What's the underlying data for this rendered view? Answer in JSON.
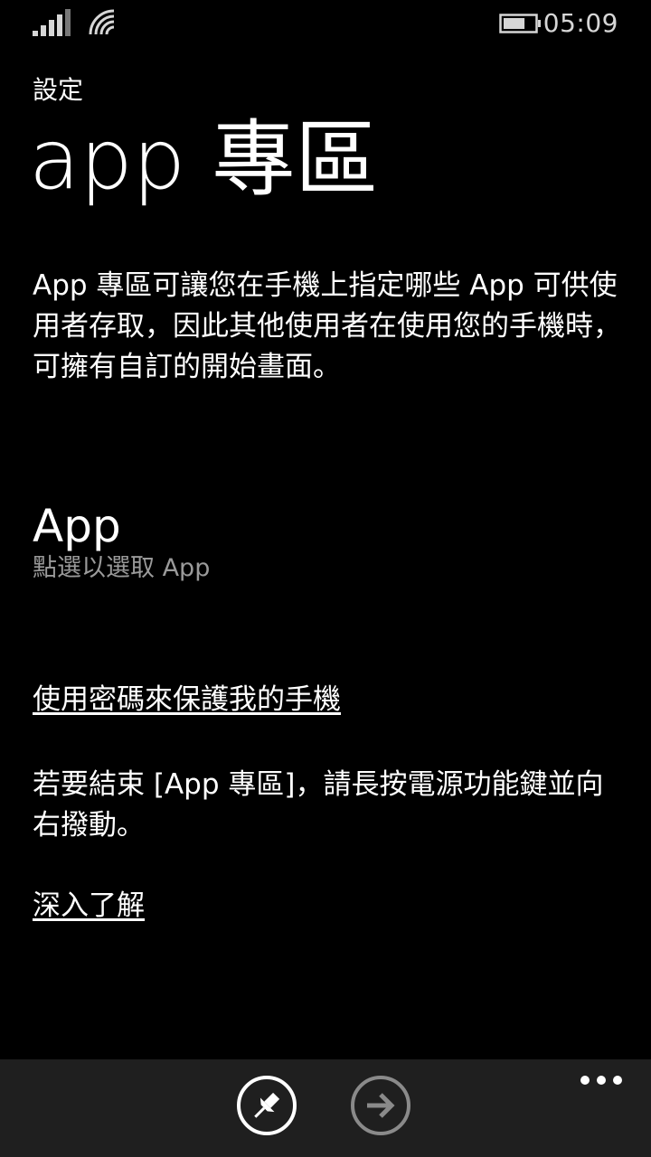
{
  "status_bar": {
    "time": "05:09",
    "signal_icon": "signal-bars-icon",
    "wifi_icon": "wifi-icon",
    "battery_icon": "battery-icon",
    "battery_level": 0.7
  },
  "header": {
    "app_name": "設定",
    "title": "app 專區"
  },
  "main": {
    "description": "App 專區可讓您在手機上指定哪些 App 可供使用者存取，因此其他使用者在使用您的手機時，可擁有自訂的開始畫面。",
    "app_setting": {
      "title": "App",
      "subtitle": "點選以選取 App"
    },
    "password_link": "使用密碼來保護我的手機",
    "end_info": "若要結束 [App 專區]，請長按電源功能鍵並向右撥動。",
    "learn_more": "深入了解"
  },
  "app_bar": {
    "pin_icon": "pin-icon",
    "next_icon": "arrow-right-icon",
    "more_icon": "more-dots-icon",
    "next_enabled": false
  }
}
